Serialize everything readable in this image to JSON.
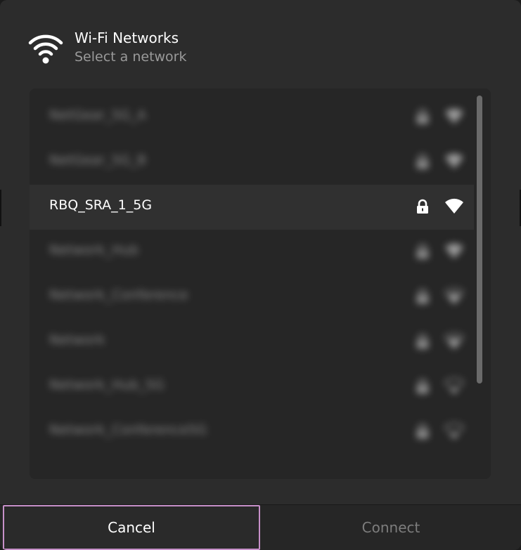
{
  "header": {
    "title": "Wi-Fi Networks",
    "subtitle": "Select a network",
    "icon": "wifi-icon"
  },
  "networks": [
    {
      "name": "NetGear_5G_A",
      "secured": true,
      "signal": "strong",
      "selected": false,
      "obscured": true
    },
    {
      "name": "NetGear_5G_B",
      "secured": true,
      "signal": "strong",
      "selected": false,
      "obscured": true
    },
    {
      "name": "RBQ_SRA_1_5G",
      "secured": true,
      "signal": "strong",
      "selected": true,
      "obscured": false
    },
    {
      "name": "Network_Hub",
      "secured": true,
      "signal": "strong",
      "selected": false,
      "obscured": true
    },
    {
      "name": "Network_Conference",
      "secured": true,
      "signal": "medium",
      "selected": false,
      "obscured": true
    },
    {
      "name": "Network",
      "secured": true,
      "signal": "medium",
      "selected": false,
      "obscured": true
    },
    {
      "name": "Network_Hub_5G",
      "secured": true,
      "signal": "weak",
      "selected": false,
      "obscured": true
    },
    {
      "name": "Network_Conference5G",
      "secured": true,
      "signal": "weak",
      "selected": false,
      "obscured": true
    }
  ],
  "footer": {
    "cancel_label": "Cancel",
    "connect_label": "Connect"
  },
  "colors": {
    "focus_ring": "#c790c9",
    "dialog_bg": "#2c2c2c",
    "list_bg": "#262626"
  }
}
